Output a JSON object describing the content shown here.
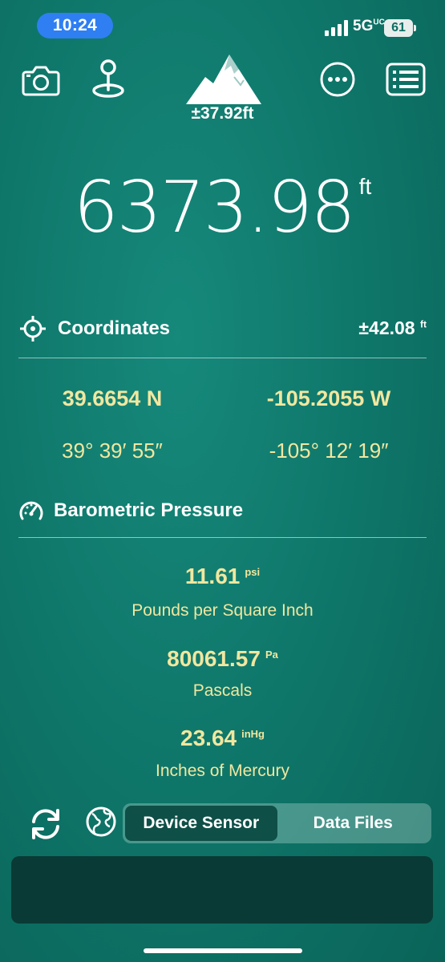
{
  "status_bar": {
    "time": "10:24",
    "network": "5G",
    "network_suffix": "UC",
    "battery": "61"
  },
  "toolbar": {
    "icons": [
      "camera-icon",
      "map-pin-icon",
      "mountain-icon",
      "more-icon",
      "list-icon"
    ],
    "elevation_accuracy": "±37.92ft"
  },
  "elevation": {
    "value": "6373.98",
    "unit": "ft"
  },
  "coordinates": {
    "title": "Coordinates",
    "accuracy_value": "±42.08",
    "accuracy_unit": "ft",
    "latitude_decimal": "39.6654 N",
    "longitude_decimal": "-105.2055 W",
    "latitude_dms": "39° 39′ 55″",
    "longitude_dms": "-105° 12′ 19″"
  },
  "pressure": {
    "title": "Barometric Pressure",
    "readings": [
      {
        "value": "11.61",
        "unit": "psi",
        "label": "Pounds per Square Inch"
      },
      {
        "value": "80061.57",
        "unit": "Pa",
        "label": "Pascals"
      },
      {
        "value": "23.64",
        "unit": "inHg",
        "label": "Inches of Mercury"
      }
    ]
  },
  "source_selector": {
    "options": [
      "Device Sensor",
      "Data Files"
    ],
    "selected": "Device Sensor"
  },
  "colors": {
    "background": "#0f786b",
    "accent_text": "#f1e7a0",
    "time_pill": "#2f7ff2",
    "segment_active": "#0e4f47",
    "panel": "#0a3a35"
  }
}
